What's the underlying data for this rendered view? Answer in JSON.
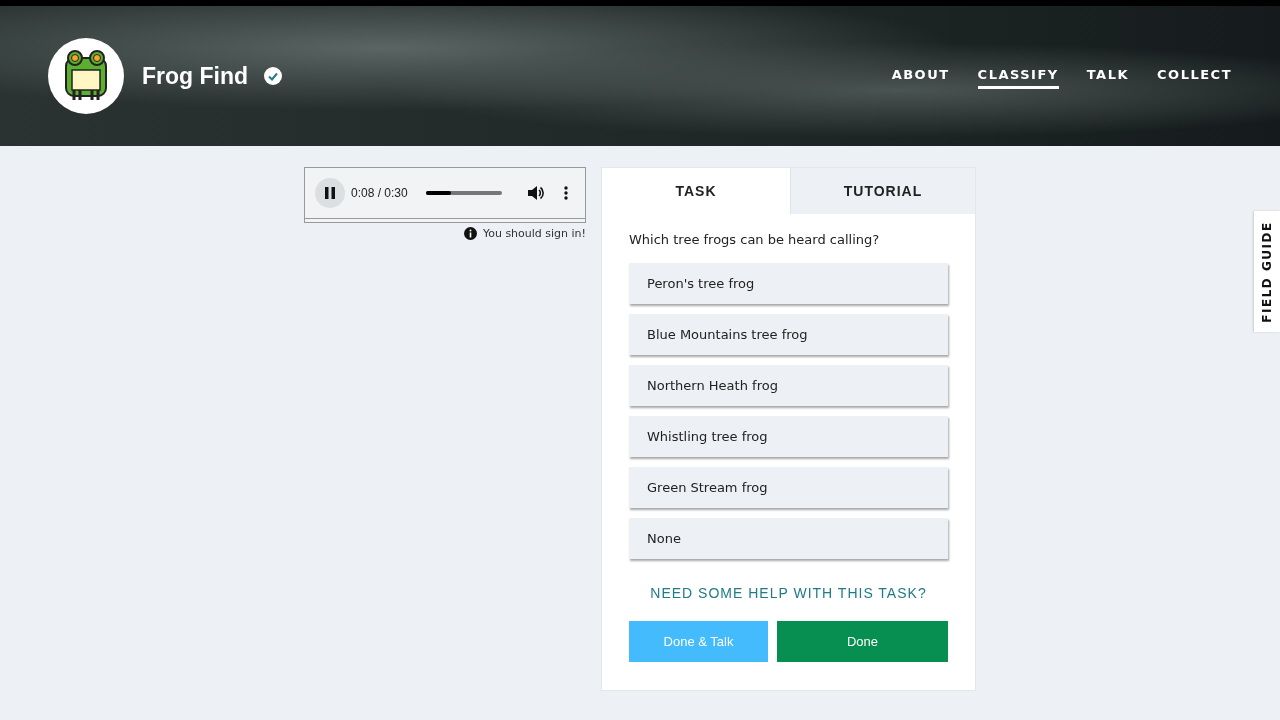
{
  "header": {
    "project_title": "Frog Find",
    "nav": [
      {
        "label": "ABOUT",
        "selected": false
      },
      {
        "label": "CLASSIFY",
        "selected": true
      },
      {
        "label": "TALK",
        "selected": false
      },
      {
        "label": "COLLECT",
        "selected": false
      }
    ]
  },
  "audio_player": {
    "playing": true,
    "time": "0:08 / 0:30",
    "level": 0.33
  },
  "sign_in_notice": "You should sign in!",
  "tabs": [
    {
      "label": "TASK",
      "selected": true
    },
    {
      "label": "TUTORIAL",
      "selected": false
    }
  ],
  "question": "Which tree frogs can be heard calling?",
  "answers": [
    "Peron's tree frog",
    "Blue Mountains tree frog",
    "Northern Heath frog",
    "Whistling tree frog",
    "Green Stream frog",
    "None"
  ],
  "help_link": "NEED SOME HELP WITH THIS TASK?",
  "buttons": [
    {
      "kind": "talk",
      "label": "Done & Talk"
    },
    {
      "kind": "done",
      "label": "Done"
    }
  ],
  "field_guide": "FIELD GUIDE"
}
